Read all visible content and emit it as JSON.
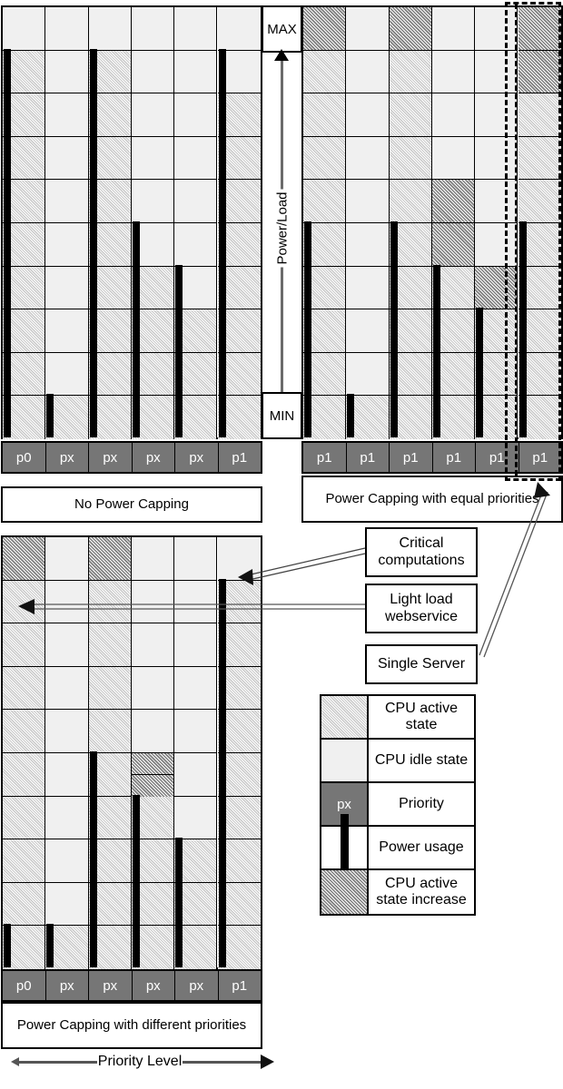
{
  "figure": {
    "axis": {
      "max_label": "MAX",
      "min_label": "MIN",
      "vertical_label": "Power/Load",
      "horizontal_label": "Priority Level"
    },
    "legend": {
      "items": [
        {
          "swatch": "active",
          "label": "CPU active state",
          "swatch_text": ""
        },
        {
          "swatch": "idle",
          "label": "CPU idle state",
          "swatch_text": ""
        },
        {
          "swatch": "priority",
          "label": "Priority",
          "swatch_text": "px"
        },
        {
          "swatch": "powerbar",
          "label": "Power usage",
          "swatch_text": ""
        },
        {
          "swatch": "increase",
          "label": "CPU active state increase",
          "swatch_text": ""
        }
      ]
    },
    "callouts": [
      {
        "id": "critical",
        "label": "Critical computations"
      },
      {
        "id": "lightload",
        "label": "Light load webservice"
      },
      {
        "id": "single-server",
        "label": "Single Server"
      }
    ],
    "colors": {
      "idle": "#f0f0f0",
      "active_hatch": "#c9c9c9",
      "increase": "#b5b5b5",
      "priority": "#767676",
      "power_bar": "#000000",
      "grid_line": "#000000"
    }
  },
  "chart_data": [
    {
      "id": "no-power-capping",
      "type": "heatmap",
      "title": "No Power Capping",
      "xlabel": "Priority Level",
      "ylabel": "Power/Load",
      "ylim": [
        "MIN",
        "MAX"
      ],
      "rows": 10,
      "categories": [
        "p0",
        "px",
        "px",
        "px",
        "px",
        "p1"
      ],
      "priority_labels": [
        "p0",
        "px",
        "px",
        "px",
        "px",
        "p1"
      ],
      "series": [
        {
          "name": "CPU active rows (from bottom)",
          "values": [
            9,
            1,
            9,
            4,
            3,
            8
          ]
        },
        {
          "name": "Power usage bar (rows from bottom)",
          "values": [
            9,
            1,
            9,
            5,
            4,
            9
          ]
        },
        {
          "name": "CPU active state increase rows",
          "values": [
            0,
            0,
            0,
            0,
            0,
            0
          ]
        }
      ],
      "cells": [
        [
          "idle",
          "idle",
          "idle",
          "idle",
          "idle",
          "idle"
        ],
        [
          "active",
          "idle",
          "active",
          "idle",
          "idle",
          "idle"
        ],
        [
          "active",
          "idle",
          "active",
          "idle",
          "idle",
          "active"
        ],
        [
          "active",
          "idle",
          "active",
          "idle",
          "idle",
          "active"
        ],
        [
          "active",
          "idle",
          "active",
          "idle",
          "idle",
          "active"
        ],
        [
          "active",
          "idle",
          "active",
          "idle",
          "idle",
          "active"
        ],
        [
          "active",
          "idle",
          "active",
          "active",
          "idle",
          "active"
        ],
        [
          "active",
          "idle",
          "active",
          "active",
          "active",
          "active"
        ],
        [
          "active",
          "idle",
          "active",
          "active",
          "active",
          "active"
        ],
        [
          "active",
          "active",
          "active",
          "active",
          "active",
          "active"
        ]
      ]
    },
    {
      "id": "power-capping-equal",
      "type": "heatmap",
      "title": "Power Capping with equal priorities",
      "xlabel": "Priority Level",
      "ylabel": "Power/Load",
      "ylim": [
        "MIN",
        "MAX"
      ],
      "rows": 10,
      "categories": [
        "p1",
        "p1",
        "p1",
        "p1",
        "p1",
        "p1"
      ],
      "priority_labels": [
        "p1",
        "p1",
        "p1",
        "p1",
        "p1",
        "p1"
      ],
      "highlighted_column_index": 5,
      "series": [
        {
          "name": "CPU active rows (from bottom)",
          "values": [
            10,
            1,
            10,
            9,
            5,
            10
          ]
        },
        {
          "name": "Power usage bar (rows from bottom)",
          "values": [
            5,
            1,
            5,
            4,
            3,
            5
          ]
        },
        {
          "name": "CPU active state increase rows",
          "values": [
            1,
            0,
            1,
            2,
            1,
            2
          ]
        }
      ],
      "cells": [
        [
          "increase",
          "idle",
          "increase",
          "idle",
          "idle",
          "increase"
        ],
        [
          "active",
          "idle",
          "active",
          "idle",
          "idle",
          "increase"
        ],
        [
          "active",
          "idle",
          "active",
          "idle",
          "idle",
          "active"
        ],
        [
          "active",
          "idle",
          "active",
          "idle",
          "idle",
          "active"
        ],
        [
          "active",
          "idle",
          "active",
          "increase",
          "idle",
          "active"
        ],
        [
          "active",
          "idle",
          "active",
          "increase",
          "idle",
          "active"
        ],
        [
          "active",
          "idle",
          "active",
          "active",
          "increase",
          "active"
        ],
        [
          "active",
          "idle",
          "active",
          "active",
          "active",
          "active"
        ],
        [
          "active",
          "idle",
          "active",
          "active",
          "active",
          "active"
        ],
        [
          "active",
          "active",
          "active",
          "active",
          "active",
          "active"
        ]
      ]
    },
    {
      "id": "power-capping-different",
      "type": "heatmap",
      "title": "Power Capping with different priorities",
      "xlabel": "Priority Level",
      "ylabel": "Power/Load",
      "ylim": [
        "MIN",
        "MAX"
      ],
      "rows": 10,
      "categories": [
        "p0",
        "px",
        "px",
        "px",
        "px",
        "p1"
      ],
      "priority_labels": [
        "p0",
        "px",
        "px",
        "px",
        "px",
        "p1"
      ],
      "series": [
        {
          "name": "CPU active rows (from bottom)",
          "values": [
            10,
            1,
            10,
            5,
            4,
            9
          ]
        },
        {
          "name": "Power usage bar (rows from bottom)",
          "values": [
            1,
            1,
            5,
            4,
            3,
            9
          ]
        },
        {
          "name": "CPU active state increase rows",
          "values": [
            1,
            0,
            1,
            1,
            0,
            0
          ]
        }
      ],
      "cells": [
        [
          "increase",
          "idle",
          "increase",
          "idle",
          "idle",
          "idle"
        ],
        [
          "active",
          "idle",
          "active",
          "idle",
          "idle",
          "active"
        ],
        [
          "active",
          "idle",
          "active",
          "idle",
          "idle",
          "active"
        ],
        [
          "active",
          "idle",
          "active",
          "idle",
          "idle",
          "active"
        ],
        [
          "active",
          "idle",
          "active",
          "idle",
          "idle",
          "active"
        ],
        [
          "active",
          "idle",
          "active",
          "increase",
          "idle",
          "active"
        ],
        [
          "active",
          "idle",
          "active",
          "active",
          "idle",
          "active"
        ],
        [
          "active",
          "idle",
          "active",
          "active",
          "active",
          "active"
        ],
        [
          "active",
          "idle",
          "active",
          "active",
          "active",
          "active"
        ],
        [
          "active",
          "active",
          "active",
          "active",
          "active",
          "active"
        ]
      ]
    }
  ]
}
